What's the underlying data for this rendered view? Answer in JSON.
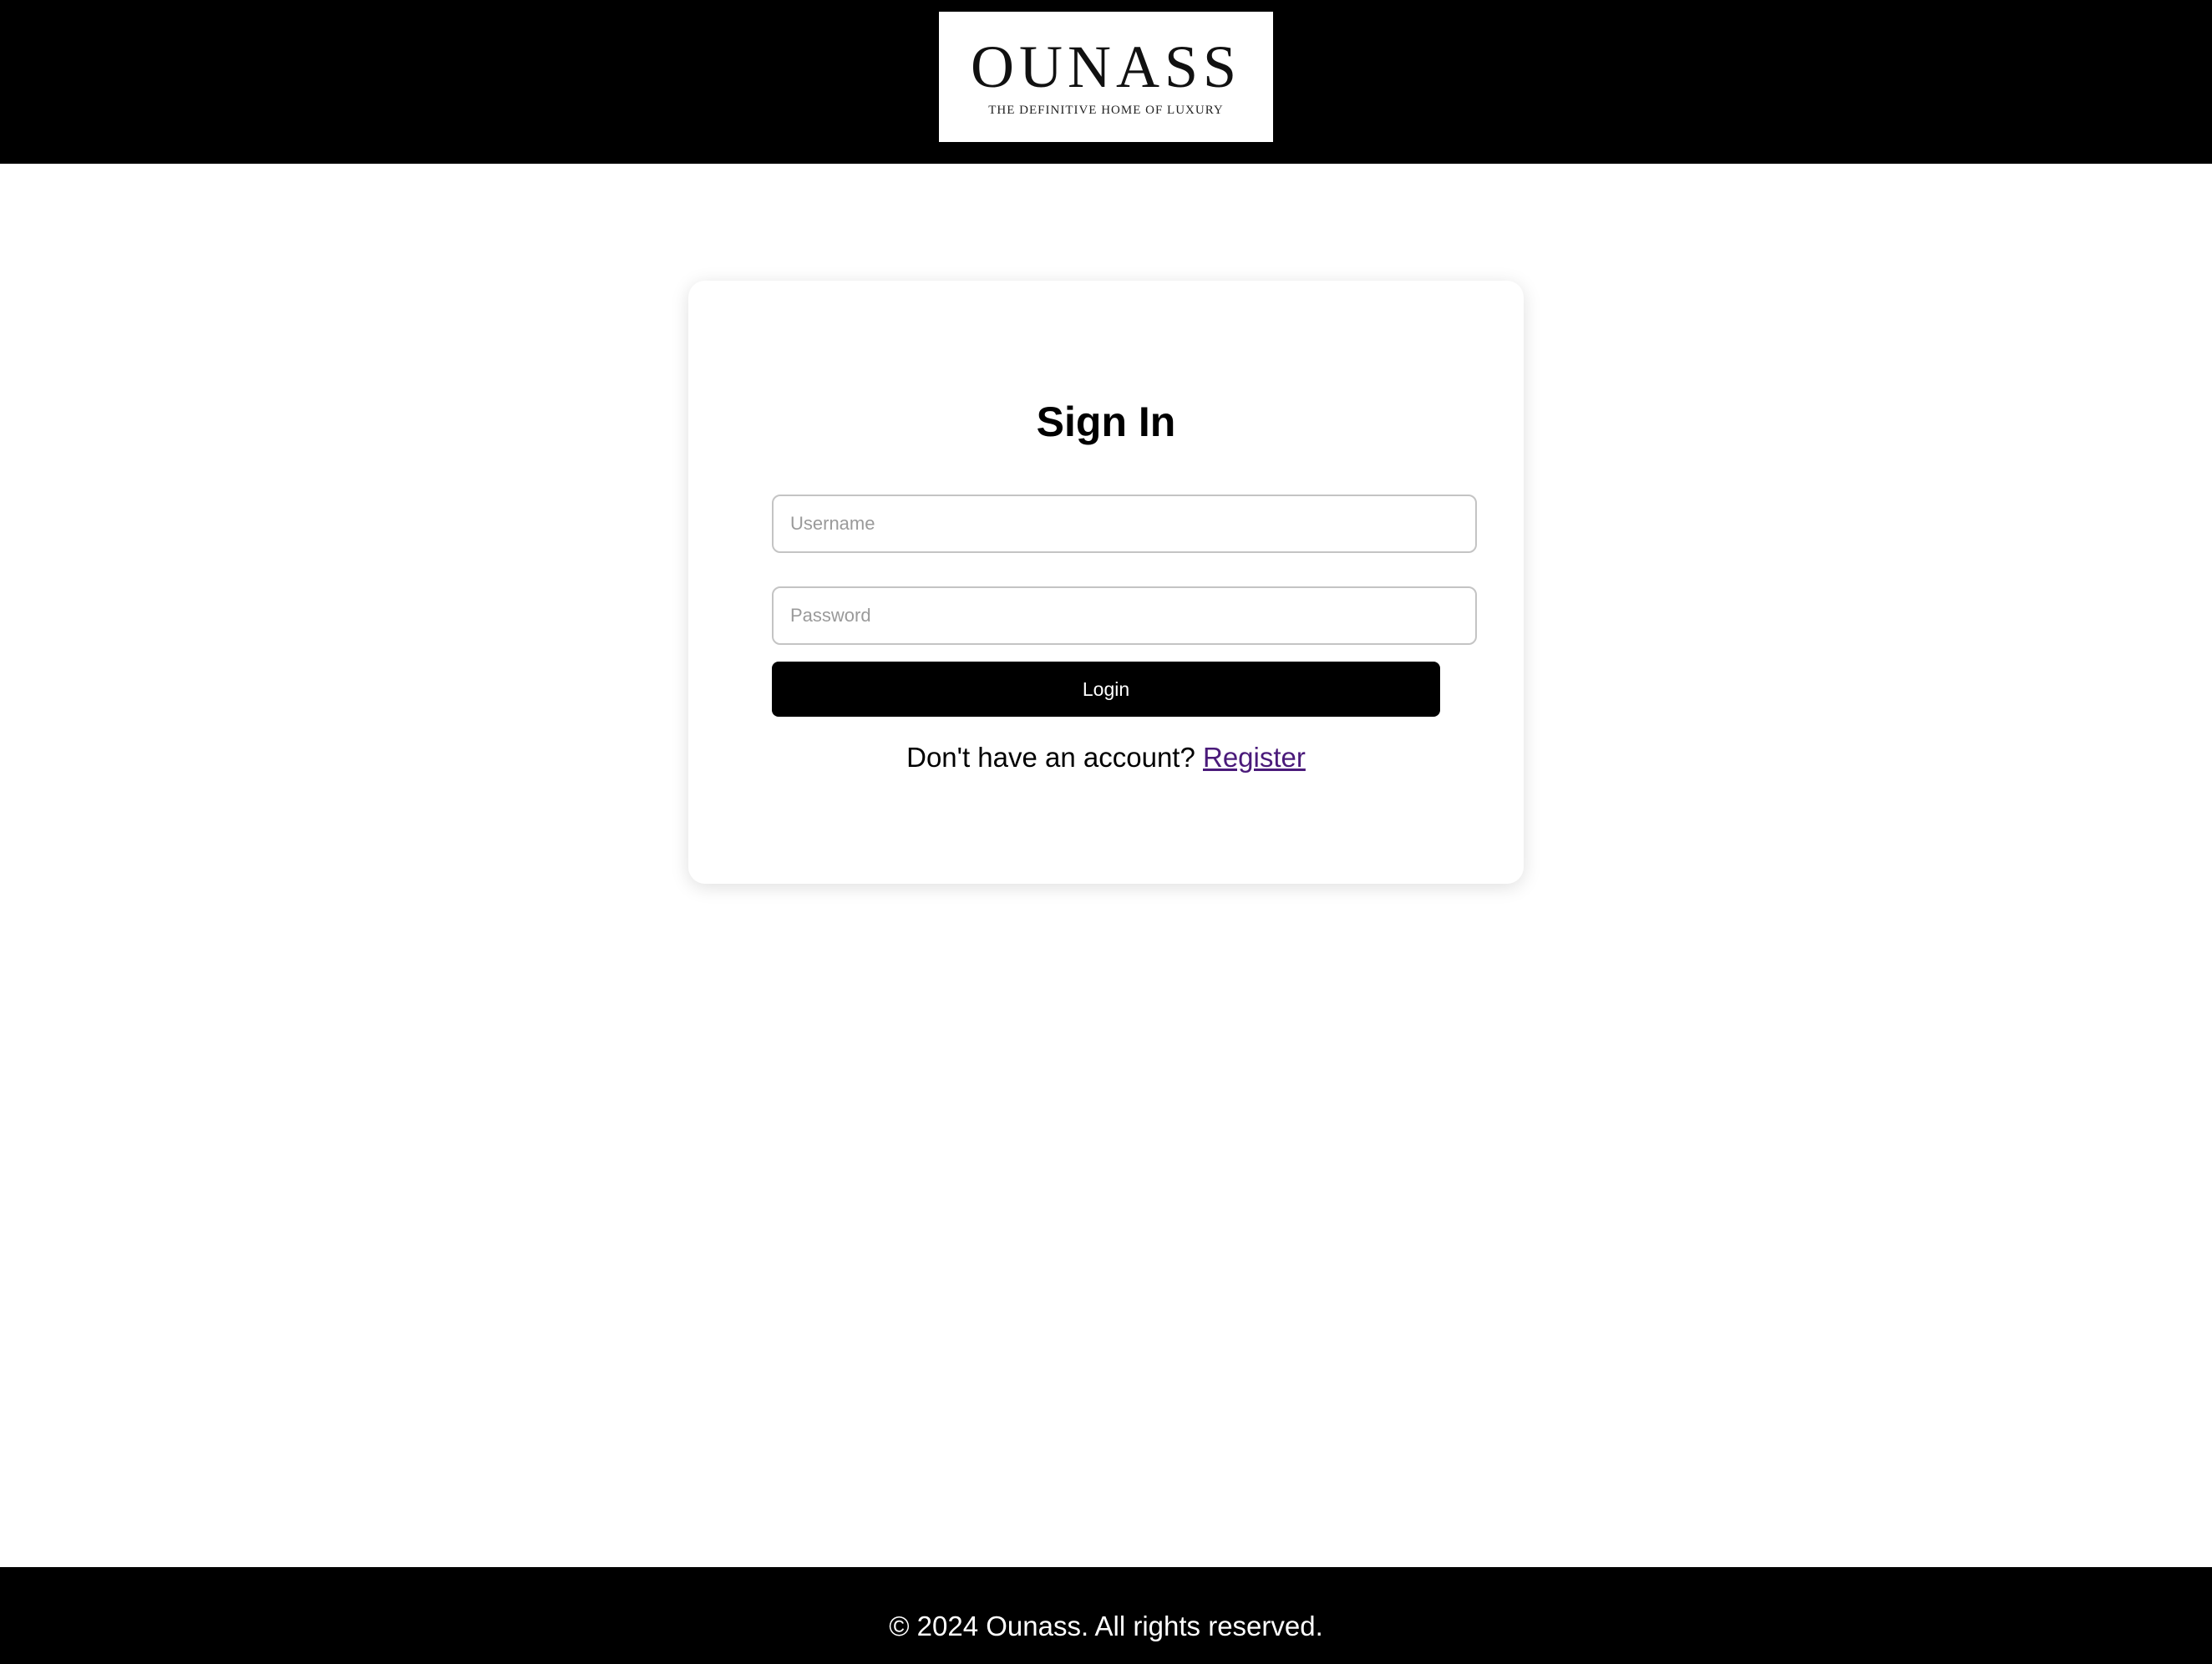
{
  "header": {
    "logo": {
      "wordmark": "OUNASS",
      "tagline": "THE DEFINITIVE HOME OF LUXURY"
    }
  },
  "signin": {
    "title": "Sign In",
    "username": {
      "placeholder": "Username",
      "value": ""
    },
    "password": {
      "placeholder": "Password",
      "value": ""
    },
    "login_label": "Login",
    "register_prompt": "Don't have an account?",
    "register_link": "Register"
  },
  "footer": {
    "copyright": "© 2024 Ounass. All rights reserved."
  },
  "colors": {
    "header_bg": "#000000",
    "button_bg": "#000000",
    "link": "#4a1a7a"
  }
}
